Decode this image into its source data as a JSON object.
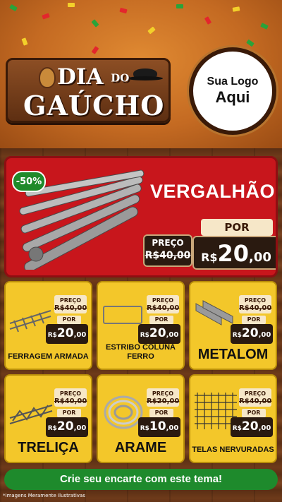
{
  "header": {
    "title_line1": "DIA",
    "title_do": "DO",
    "title_line2": "GAÚCHO",
    "brand_line1": "Sua Logo",
    "brand_line2": "Aqui"
  },
  "hero": {
    "discount": "-50%",
    "title": "VERGALHÃO",
    "price_label": "PREÇO",
    "old_price": "R$40,00",
    "por_label": "POR",
    "currency": "R$",
    "price_int": "20",
    "price_cents": ",00"
  },
  "products": [
    {
      "name": "FERRAGEM ARMADA",
      "old": "R$40,00",
      "cur": "R$",
      "int": "20",
      "cents": ",00"
    },
    {
      "name": "ESTRIBO COLUNA FERRO",
      "old": "R$40,00",
      "cur": "R$",
      "int": "20",
      "cents": ",00"
    },
    {
      "name": "METALOM",
      "old": "R$40,00",
      "cur": "R$",
      "int": "20",
      "cents": ",00"
    },
    {
      "name": "TRELIÇA",
      "old": "R$40,00",
      "cur": "R$",
      "int": "20",
      "cents": ",00"
    },
    {
      "name": "ARAME",
      "old": "R$20,00",
      "cur": "R$",
      "int": "10",
      "cents": ",00"
    },
    {
      "name": "TELAS NERVURADAS",
      "old": "R$40,00",
      "cur": "R$",
      "int": "20",
      "cents": ",00"
    }
  ],
  "labels": {
    "preco": "PREÇO",
    "por": "POR"
  },
  "cta": "Crie seu encarte com este tema!",
  "footer_note": "*Imagens Meramente Ilustrativas",
  "colors": {
    "accent_red": "#c8161c",
    "card_yellow": "#f3c72a",
    "cta_green": "#1e8a2c"
  }
}
